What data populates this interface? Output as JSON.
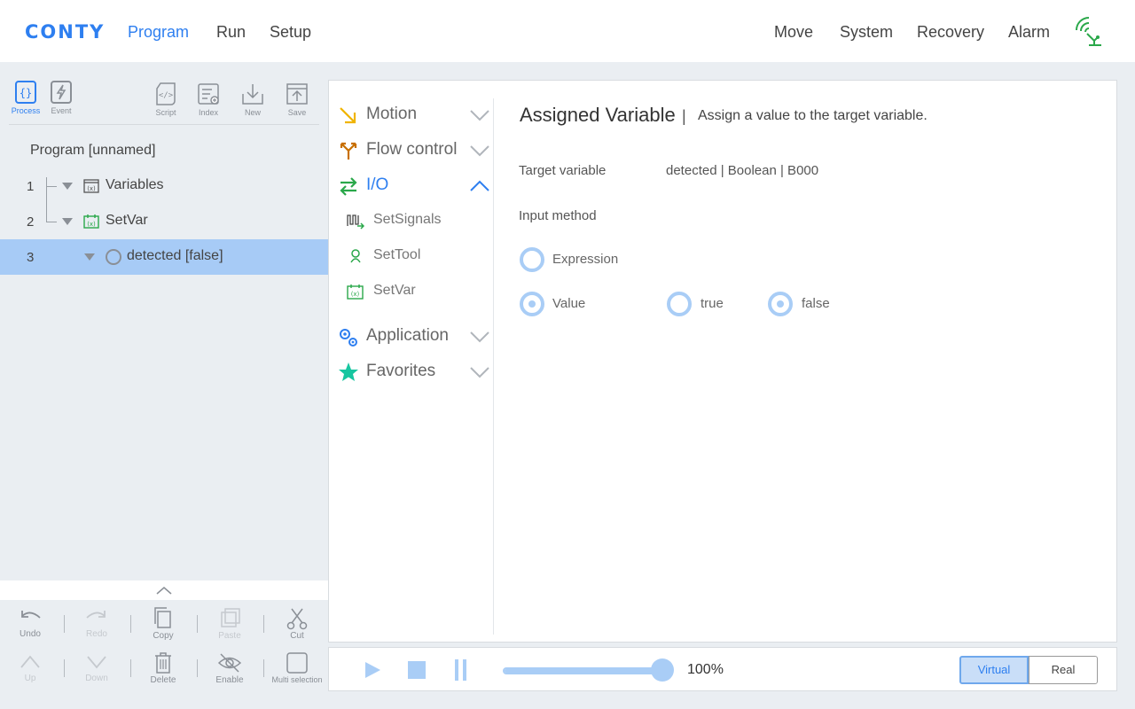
{
  "app": {
    "logo": "CONTY"
  },
  "topnav": {
    "left": [
      "Program",
      "Run",
      "Setup"
    ],
    "right": [
      "Move",
      "System",
      "Recovery",
      "Alarm"
    ],
    "active": "Program"
  },
  "toolbar": {
    "process": "Process",
    "event": "Event",
    "script": "Script",
    "index": "Index",
    "new": "New",
    "save": "Save"
  },
  "tree": {
    "title": "Program [unnamed]",
    "rows": [
      {
        "num": "1",
        "label": "Variables",
        "icon": "variables-icon"
      },
      {
        "num": "2",
        "label": "SetVar",
        "icon": "setvar-icon"
      },
      {
        "num": "3",
        "label": "detected [false]",
        "icon": "circle-icon"
      }
    ]
  },
  "edit_tools": {
    "undo": "Undo",
    "redo": "Redo",
    "copy": "Copy",
    "paste": "Paste",
    "cut": "Cut",
    "up": "Up",
    "down": "Down",
    "delete": "Delete",
    "enable": "Enable",
    "multi": "Multi selection"
  },
  "categories": {
    "motion": "Motion",
    "flow": "Flow control",
    "io": "I/O",
    "io_items": [
      "SetSignals",
      "SetTool",
      "SetVar"
    ],
    "application": "Application",
    "favorites": "Favorites"
  },
  "detail": {
    "title": "Assigned Variable",
    "separator": "|",
    "description": "Assign a value to the target variable.",
    "target_label": "Target variable",
    "target_value": "detected | Boolean | B000",
    "input_label": "Input method",
    "expression": "Expression",
    "value": "Value",
    "true_label": "true",
    "false_label": "false"
  },
  "runbar": {
    "speed": "100%",
    "speed_value": 1.0,
    "virtual": "Virtual",
    "real": "Real"
  },
  "colors": {
    "accent": "#2e7ff0",
    "selection": "#a7cbf6",
    "radio": "#a9cdf6"
  }
}
